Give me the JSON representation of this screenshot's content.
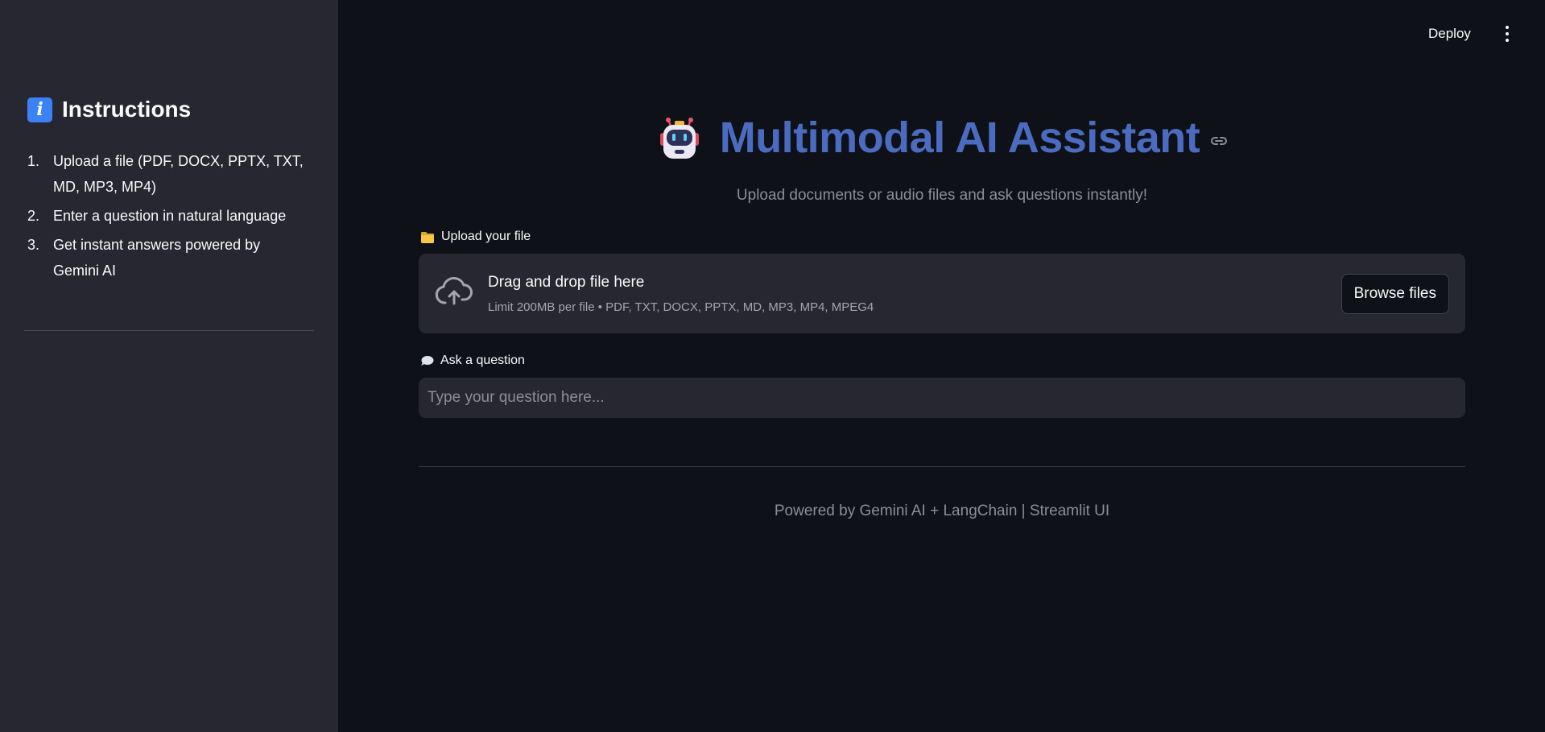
{
  "header": {
    "deploy_label": "Deploy",
    "menu_icon": "kebab-menu-icon"
  },
  "sidebar": {
    "title": "Instructions",
    "title_icon": "info-icon",
    "items": [
      {
        "number": "1.",
        "text": "Upload a file (PDF, DOCX, PPTX, TXT, MD, MP3, MP4)"
      },
      {
        "number": "2.",
        "text": "Enter a question in natural language"
      },
      {
        "number": "3.",
        "text": "Get instant answers powered by Gemini AI"
      }
    ]
  },
  "main": {
    "title": "Multimodal AI Assistant",
    "title_icon": "robot-icon",
    "subtitle": "Upload documents or audio files and ask questions instantly!",
    "accent_color": "#4a6bbf"
  },
  "upload": {
    "label": "Upload your file",
    "label_icon": "folder-icon",
    "drop_text": "Drag and drop file here",
    "limit_text": "Limit 200MB per file • PDF, TXT, DOCX, PPTX, MD, MP3, MP4, MPEG4",
    "browse_label": "Browse files"
  },
  "question": {
    "label": "Ask a question",
    "label_icon": "speech-bubble-icon",
    "placeholder": "Type your question here...",
    "value": ""
  },
  "footer": {
    "text": "Powered by Gemini AI + LangChain | Streamlit UI"
  }
}
